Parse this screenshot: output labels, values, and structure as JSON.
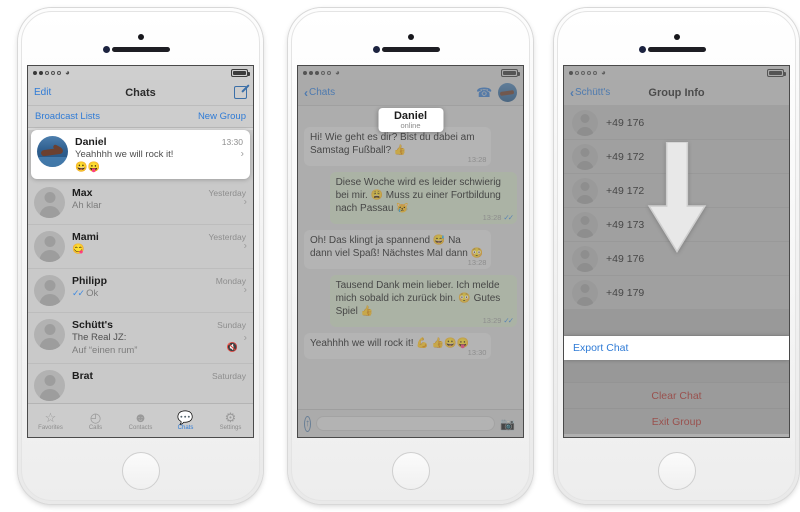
{
  "meta": {
    "background": "#ffffff",
    "accent_blue": "#2f7bd6",
    "danger_red": "#b0352f",
    "bubble_out": "#cfddc4",
    "bubble_in": "#dedede"
  },
  "phone1": {
    "statusbar": {
      "carrier_dots": 5,
      "dots_filled": 2,
      "wifi": "wifi-icon",
      "battery": "battery-full-icon"
    },
    "navbar": {
      "left_label": "Edit",
      "title": "Chats",
      "right_icon": "compose-icon"
    },
    "broadcast": {
      "left": "Broadcast Lists",
      "right": "New Group"
    },
    "chats": [
      {
        "name": "Daniel",
        "time": "13:30",
        "message": "Yeahhhh we will rock it!",
        "emoji": "😀😛",
        "avatar": "photo-swimmer",
        "highlighted": true,
        "ticks": false,
        "muted": false,
        "sub": ""
      },
      {
        "name": "Max",
        "time": "Yesterday",
        "message": "Ah klar",
        "emoji": "",
        "avatar": "person-placeholder",
        "highlighted": false,
        "ticks": false,
        "muted": false,
        "sub": ""
      },
      {
        "name": "Mami",
        "time": "Yesterday",
        "message": "",
        "emoji": "😋",
        "avatar": "person-placeholder",
        "highlighted": false,
        "ticks": false,
        "muted": false,
        "sub": ""
      },
      {
        "name": "Philipp",
        "time": "Monday",
        "message": "Ok",
        "emoji": "",
        "avatar": "person-placeholder",
        "highlighted": false,
        "ticks": true,
        "muted": false,
        "sub": ""
      },
      {
        "name": "Schütt's",
        "time": "Sunday",
        "message": "The Real JZ:",
        "emoji": "",
        "avatar": "person-placeholder",
        "highlighted": false,
        "ticks": false,
        "muted": true,
        "sub": "Auf “einen rum”"
      },
      {
        "name": "Brat",
        "time": "Saturday",
        "message": "",
        "emoji": "",
        "avatar": "person-placeholder",
        "highlighted": false,
        "ticks": false,
        "muted": false,
        "sub": ""
      }
    ],
    "tabbar": [
      {
        "label": "Favorites",
        "icon": "star-icon",
        "active": false
      },
      {
        "label": "Calls",
        "icon": "clock-icon",
        "active": false
      },
      {
        "label": "Contacts",
        "icon": "contact-icon",
        "active": false
      },
      {
        "label": "Chats",
        "icon": "chats-icon",
        "active": true
      },
      {
        "label": "Settings",
        "icon": "settings-icon",
        "active": false
      }
    ]
  },
  "phone2": {
    "statusbar": {
      "dots_filled": 3
    },
    "navbar": {
      "back_label": "Chats",
      "contact_name": "Daniel",
      "contact_status": "online",
      "call_icon": "phone-call-icon",
      "avatar": "photo-swimmer"
    },
    "messages": [
      {
        "dir": "in",
        "text": "Hi! Wie geht es dir? Bist du dabei am Samstag Fußball? 👍",
        "time": "13:28",
        "ticks": false
      },
      {
        "dir": "out",
        "text": "Diese Woche wird es leider schwierig bei mir. 😩 Muss zu einer Fortbildung nach Passau 😿",
        "time": "13:28",
        "ticks": true
      },
      {
        "dir": "in",
        "text": "Oh! Das klingt ja spannend 😅 Na dann viel Spaß! Nächstes Mal dann 😳",
        "time": "13:28",
        "ticks": false
      },
      {
        "dir": "out",
        "text": "Tausend Dank mein lieber. Ich melde mich sobald ich zurück bin. 😳 Gutes Spiel 👍",
        "time": "13:29",
        "ticks": true
      },
      {
        "dir": "in",
        "text": "Yeahhhh we will rock it! 💪 👍😀😛",
        "time": "13:30",
        "ticks": false
      }
    ],
    "inputbar": {
      "attach_icon": "upload-circle-icon",
      "placeholder": "",
      "camera_icon": "camera-icon",
      "more_icon": "more-dots-icon",
      "mic_icon": "microphone-icon"
    }
  },
  "phone3": {
    "statusbar": {
      "dots_filled": 1
    },
    "navbar": {
      "back_label": "Schütt's",
      "title": "Group Info"
    },
    "members": [
      {
        "number": "+49 176"
      },
      {
        "number": "+49 172"
      },
      {
        "number": "+49 172"
      },
      {
        "number": "+49 173"
      },
      {
        "number": "+49 176"
      },
      {
        "number": "+49 179"
      }
    ],
    "export_label": "Export Chat",
    "actions": [
      {
        "label": "Clear Chat"
      },
      {
        "label": "Exit Group"
      }
    ],
    "overlay_icon": "down-arrow-icon"
  }
}
